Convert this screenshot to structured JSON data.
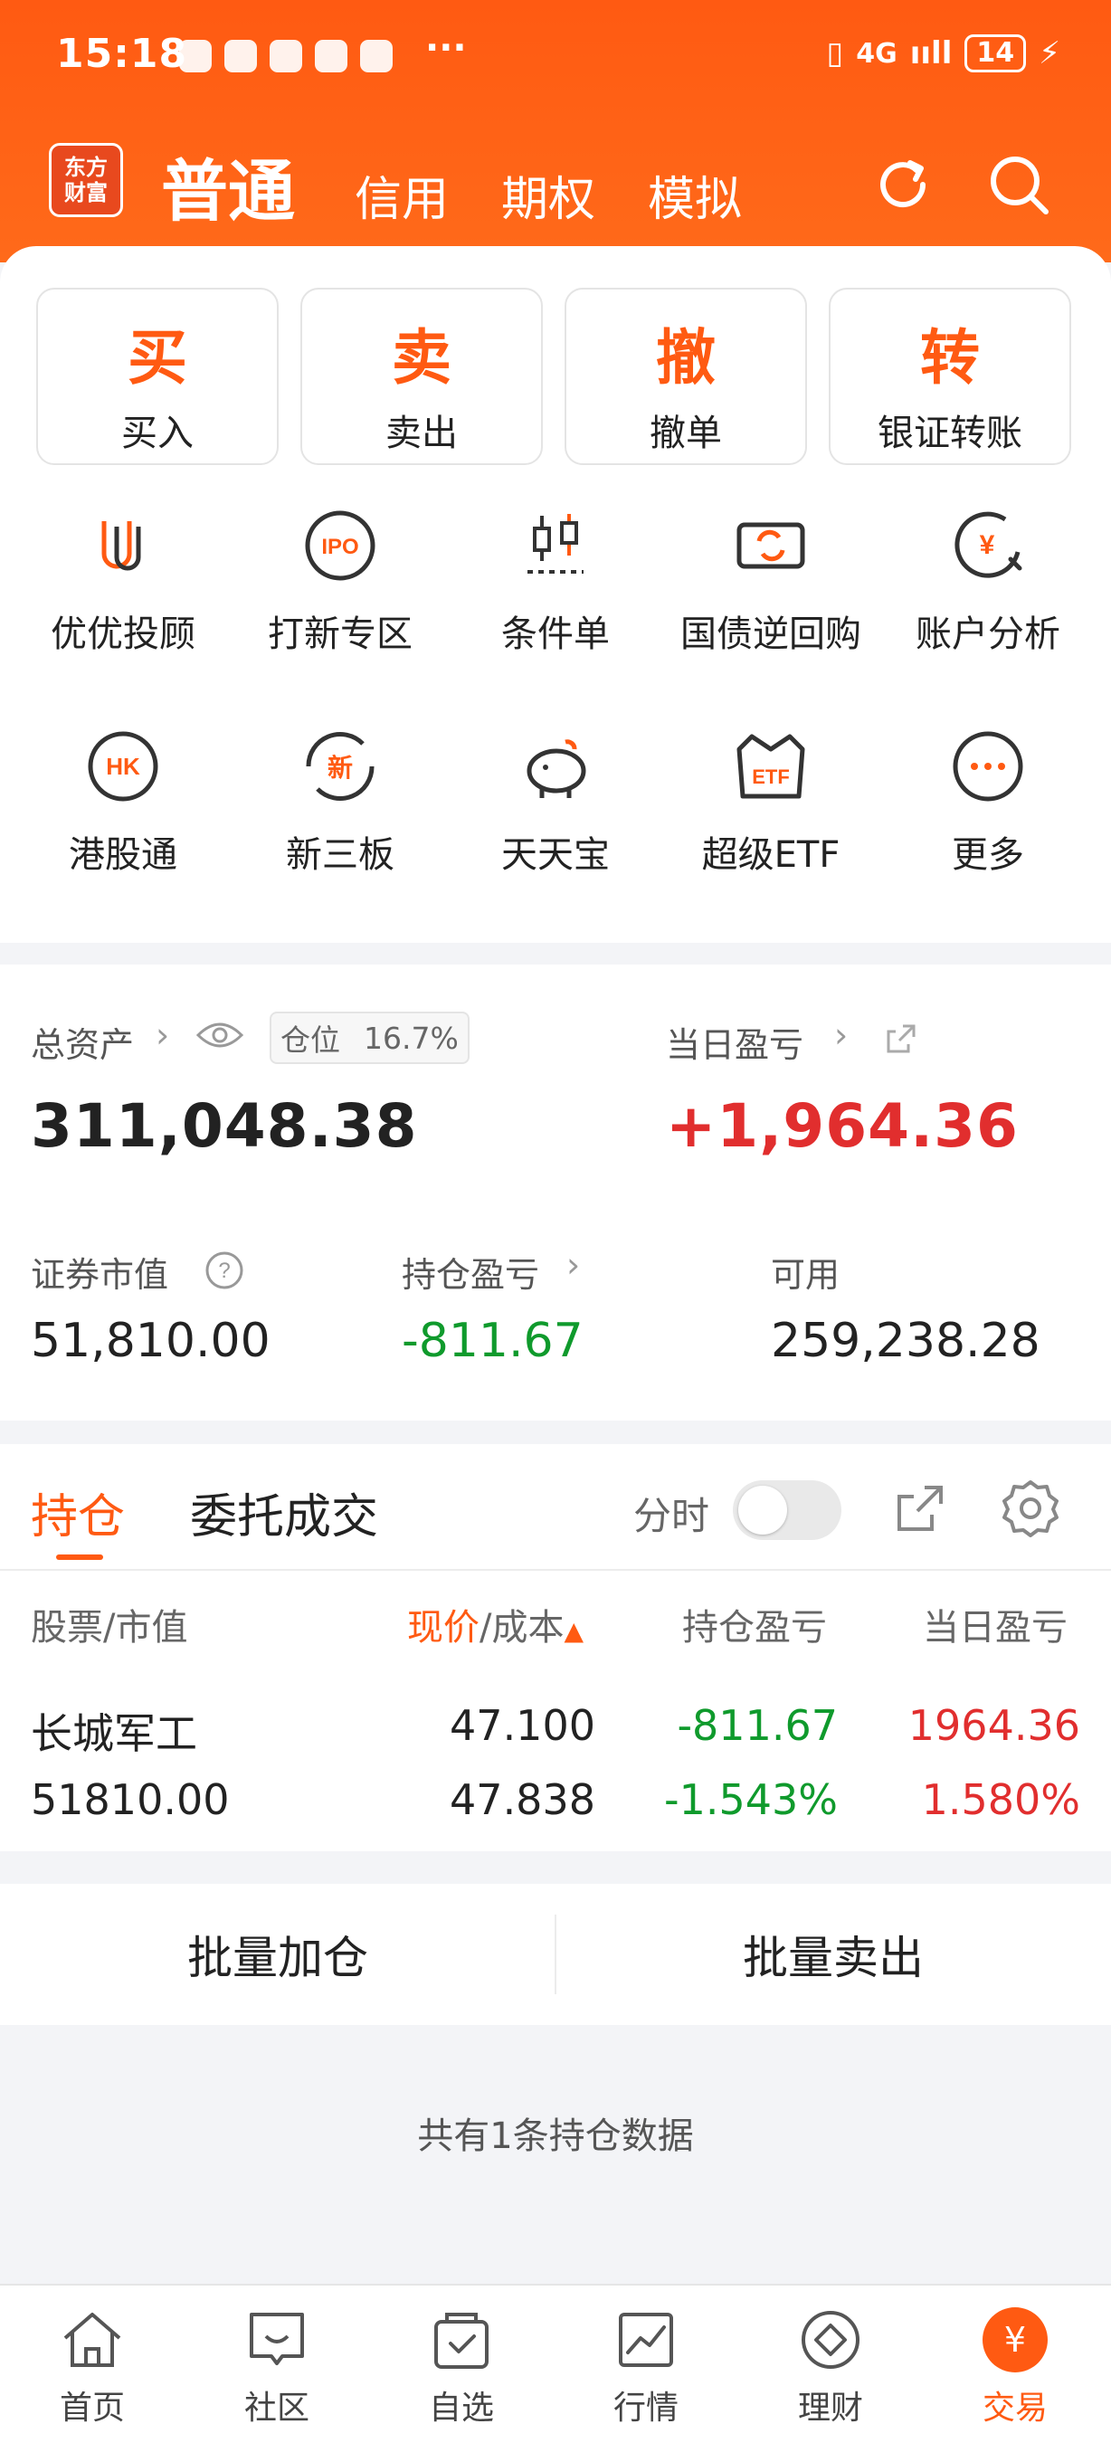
{
  "status_bar": {
    "time": "15:18",
    "more": "···",
    "network": "4G",
    "signal": "ııll",
    "battery": "14",
    "charging": "⚡",
    "vibrate": "▯"
  },
  "header": {
    "logo_line1": "东方",
    "logo_line2": "财富",
    "tabs": [
      "普通",
      "信用",
      "期权",
      "模拟"
    ],
    "active_tab": "普通"
  },
  "actions": [
    {
      "glyph": "买",
      "label": "买入"
    },
    {
      "glyph": "卖",
      "label": "卖出"
    },
    {
      "glyph": "撤",
      "label": "撤单"
    },
    {
      "glyph": "转",
      "label": "银证转账"
    }
  ],
  "features": [
    {
      "icon": "youyou-icon",
      "label": "优优投顾"
    },
    {
      "icon": "ipo-icon",
      "label": "打新专区"
    },
    {
      "icon": "condition-order-icon",
      "label": "条件单"
    },
    {
      "icon": "repo-icon",
      "label": "国债逆回购"
    },
    {
      "icon": "account-analysis-icon",
      "label": "账户分析"
    },
    {
      "icon": "hk-icon",
      "label": "港股通"
    },
    {
      "icon": "new-third-board-icon",
      "label": "新三板"
    },
    {
      "icon": "piggy-bank-icon",
      "label": "天天宝"
    },
    {
      "icon": "etf-icon",
      "label": "超级ETF"
    },
    {
      "icon": "more-icon",
      "label": "更多"
    }
  ],
  "assets": {
    "total_label": "总资产",
    "position_label": "仓位",
    "position_value": "16.7%",
    "total_value": "311,048.38",
    "daily_pnl_label": "当日盈亏",
    "daily_pnl_value": "+1,964.36",
    "market_value_label": "证券市值",
    "market_value": "51,810.00",
    "holding_pnl_label": "持仓盈亏",
    "holding_pnl": "-811.67",
    "available_label": "可用",
    "available": "259,238.28"
  },
  "holdings": {
    "tab_positions": "持仓",
    "tab_orders": "委托成交",
    "timeshare_label": "分时",
    "columns": {
      "stock": "股票/市值",
      "price_a": "现价",
      "price_b": "/成本",
      "holding_pnl": "持仓盈亏",
      "daily_pnl": "当日盈亏"
    },
    "rows": [
      {
        "name": "长城军工",
        "market_value": "51810.00",
        "price": "47.100",
        "cost": "47.838",
        "holding_pnl": "-811.67",
        "holding_pnl_pct": "-1.543%",
        "daily_pnl": "1964.36",
        "daily_pnl_pct": "1.580%"
      }
    ]
  },
  "batch": {
    "add": "批量加仓",
    "sell": "批量卖出"
  },
  "footer_note": "共有1条持仓数据",
  "bottom_nav": [
    {
      "icon": "home-icon",
      "label": "首页"
    },
    {
      "icon": "community-icon",
      "label": "社区"
    },
    {
      "icon": "watchlist-icon",
      "label": "自选"
    },
    {
      "icon": "market-icon",
      "label": "行情"
    },
    {
      "icon": "wealth-icon",
      "label": "理财"
    },
    {
      "icon": "trade-icon",
      "label": "交易"
    }
  ],
  "bottom_nav_active": "交易",
  "colors": {
    "brand": "#ff5a12",
    "up": "#e12e2e",
    "down": "#0f9a2c"
  }
}
